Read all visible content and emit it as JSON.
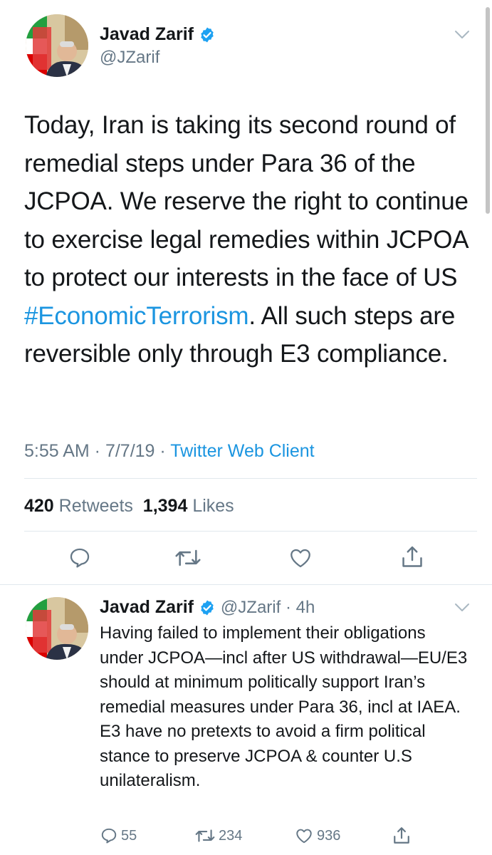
{
  "main_tweet": {
    "author_name": "Javad Zarif",
    "handle": "@JZarif",
    "text_before_hashtag": "Today, Iran is taking its second round of remedial steps under Para 36 of the JCPOA. We reserve the right to continue to exercise legal remedies within JCPOA to protect our interests in the face of US ",
    "hashtag": "#EconomicTerrorism",
    "text_after_hashtag": ". All such steps are reversible only through E3 compliance.",
    "time": "5:55 AM",
    "date": "7/7/19",
    "source": "Twitter Web Client",
    "retweets_count": "420",
    "retweets_label": "Retweets",
    "likes_count": "1,394",
    "likes_label": "Likes"
  },
  "reply_tweet": {
    "author_name": "Javad Zarif",
    "handle": "@JZarif",
    "age": "4h",
    "text": "Having failed to implement their obligations under JCPOA—incl after US withdrawal—EU/E3 should at minimum politically support Iran’s remedial measures under Para 36, incl at IAEA. E3 have no pretexts to avoid a firm political stance to preserve JCPOA & counter U.S unilateralism.",
    "reply_count": "55",
    "retweet_count": "234",
    "like_count": "936"
  },
  "colors": {
    "link": "#1b95e0",
    "secondary_text": "#657786",
    "divider": "#e1e8ed",
    "icon": "#657786"
  },
  "icons": [
    "chevron-down-icon",
    "verified-badge-icon",
    "reply-icon",
    "retweet-icon",
    "like-icon",
    "share-icon"
  ]
}
